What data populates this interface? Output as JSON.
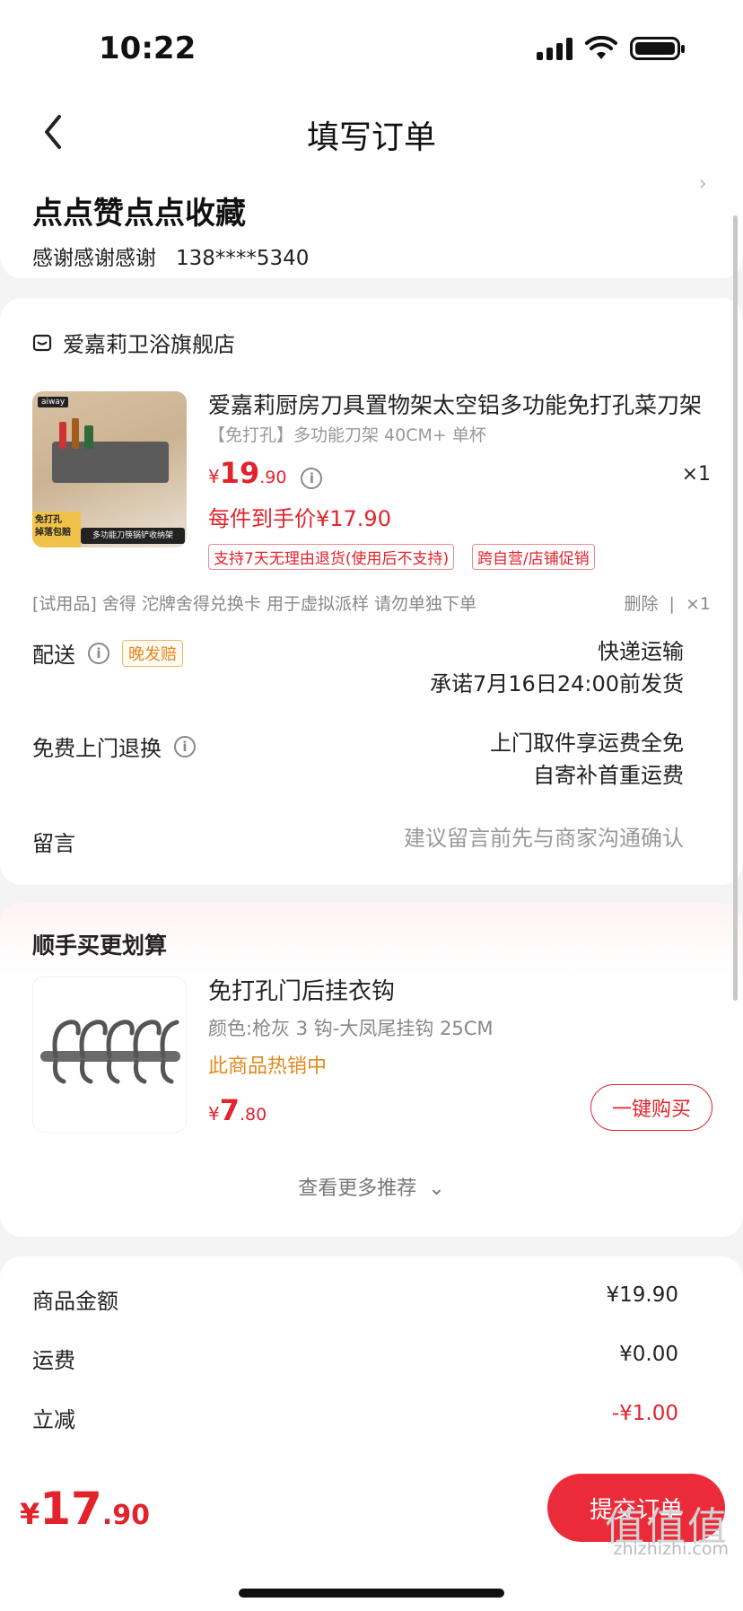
{
  "status_bar": {
    "time": "10:22"
  },
  "header": {
    "title": "填写订单"
  },
  "address": {
    "name": "点点赞点点收藏",
    "contact": "感谢感谢感谢",
    "phone": "138****5340"
  },
  "store": {
    "name": "爱嘉莉卫浴旗舰店",
    "product": {
      "title": "爱嘉莉厨房刀具置物架太空铝多功能免打孔菜刀架",
      "spec": "【免打孔】多功能刀架 40CM+ 单杯",
      "price_yen": "¥",
      "price_int": "19",
      "price_dec": ".90",
      "qty": "×1",
      "unit_price": "每件到手价¥17.90",
      "tags": [
        "支持7天无理由退货(使用后不支持)",
        "跨自营/店铺促销"
      ],
      "image_text": {
        "brand": "aiway",
        "corner": "免打孔\n掉落包赔",
        "banner": "多功能刀筷锅铲收纳架"
      }
    },
    "gift": {
      "text": "[试用品] 舍得 沱牌舍得兑换卡 用于虚拟派样 请勿单独下单",
      "delete": "删除",
      "qty": "×1"
    },
    "delivery": {
      "label": "配送",
      "tag": "晚发赔",
      "method": "快递运输",
      "promise": "承诺7月16日24:00前发货"
    },
    "return": {
      "label": "免费上门退换",
      "line1": "上门取件享运费全免",
      "line2": "自寄补首重运费"
    },
    "message": {
      "label": "留言",
      "placeholder": "建议留言前先与商家沟通确认"
    }
  },
  "recommend": {
    "title": "顺手买更划算",
    "item": {
      "name": "免打孔门后挂衣钩",
      "spec": "颜色:枪灰 3 钩-大凤尾挂钩 25CM",
      "hot": "此商品热销中",
      "price_yen": "¥",
      "price_int": "7",
      "price_dec": ".80",
      "buy": "一键购买"
    },
    "more": "查看更多推荐"
  },
  "summary": {
    "rows": [
      {
        "label": "商品金额",
        "value": "¥19.90",
        "color": "#222222"
      },
      {
        "label": "运费",
        "value": "¥0.00",
        "color": "#222222"
      },
      {
        "label": "立减",
        "value": "-¥1.00",
        "color": "#e3232c"
      }
    ]
  },
  "bottom": {
    "yen": "¥",
    "big": "17",
    "dec": ".90",
    "submit": "提交订单"
  },
  "watermark": {
    "big": "值值值",
    "small": "zhizhizhi.com"
  },
  "colors": {
    "accent": "#e3232c",
    "button": "#ec2b3a",
    "orange": "#e18a1e"
  }
}
